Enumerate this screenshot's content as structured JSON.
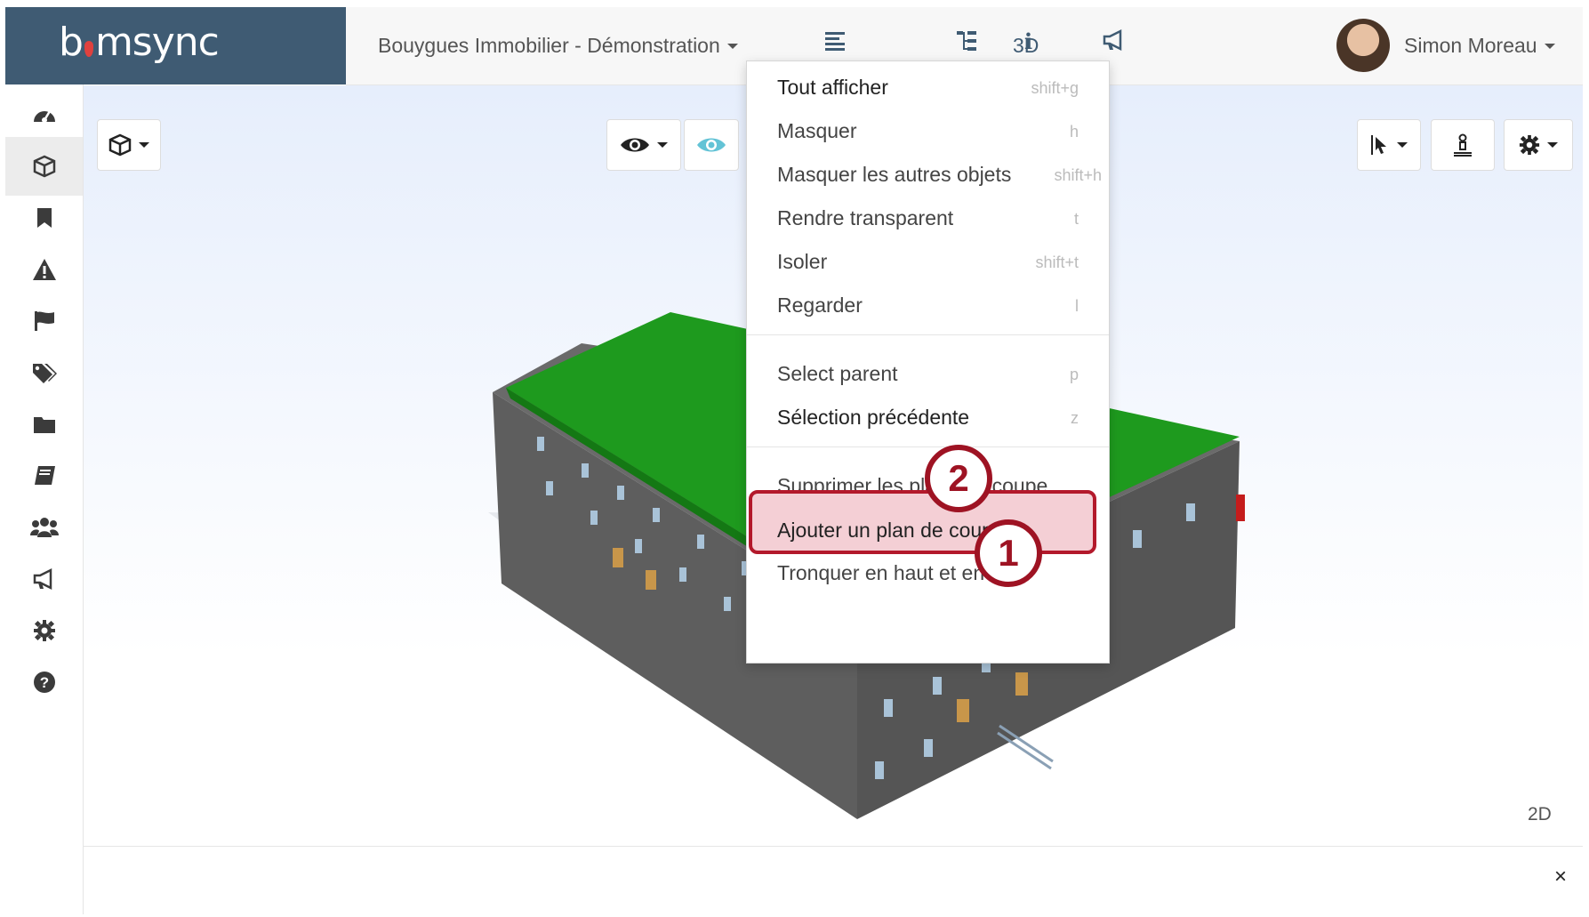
{
  "header": {
    "logo_text": "bimsync",
    "project": "Bouygues Immobilier - Démonstration",
    "view_3d_label": "3D",
    "user_name": "Simon Moreau"
  },
  "sidebar": {
    "items": [
      {
        "name": "dashboard-icon"
      },
      {
        "name": "cube-icon",
        "active": true
      },
      {
        "name": "bookmark-icon"
      },
      {
        "name": "warning-icon"
      },
      {
        "name": "flag-icon"
      },
      {
        "name": "tags-icon"
      },
      {
        "name": "folder-icon"
      },
      {
        "name": "book-icon"
      },
      {
        "name": "users-icon"
      },
      {
        "name": "megaphone-icon"
      },
      {
        "name": "gear-icon"
      },
      {
        "name": "help-icon"
      }
    ]
  },
  "viewport": {
    "label_2d": "2D",
    "close_label": "×"
  },
  "context_menu": {
    "items": [
      {
        "label": "Tout afficher",
        "shortcut": "shift+g"
      },
      {
        "label": "Masquer",
        "shortcut": "h"
      },
      {
        "label": "Masquer les autres objets",
        "shortcut": "shift+h"
      },
      {
        "label": "Rendre transparent",
        "shortcut": "t"
      },
      {
        "label": "Isoler",
        "shortcut": "shift+t"
      },
      {
        "label": "Regarder",
        "shortcut": "l"
      },
      {
        "label": "Select parent",
        "shortcut": "p"
      },
      {
        "label": "Sélection précédente",
        "shortcut": "z"
      },
      {
        "label": "Supprimer les plans de coupe",
        "shortcut": ""
      },
      {
        "label": "Ajouter un plan de coupe",
        "shortcut": ""
      },
      {
        "label": "Tronquer en haut et en bas",
        "shortcut": ""
      }
    ]
  },
  "callouts": {
    "one": "1",
    "two": "2"
  },
  "colors": {
    "brand": "#3f5b73",
    "roof": "#1e9a1e",
    "wall": "#5e5e5e",
    "highlight_border": "#b3192b",
    "highlight_fill": "#f4cfd5"
  }
}
